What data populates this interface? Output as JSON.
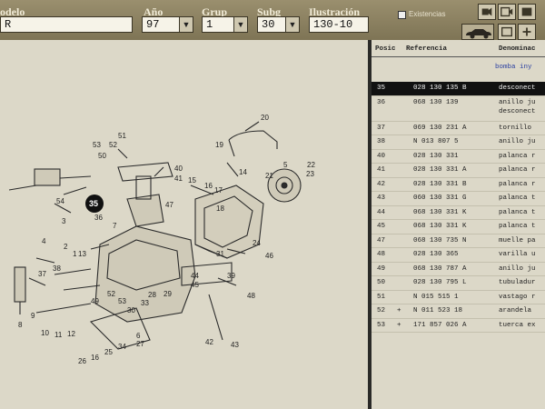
{
  "header": {
    "modelo_label": "odelo",
    "modelo_value": "R",
    "anio_label": "Año",
    "anio_value": "97",
    "grup_label": "Grup",
    "grup_value": "1",
    "subg_label": "Subg",
    "subg_value": "30",
    "ilustracion_label": "Ilustración",
    "ilustracion_value": "130-10",
    "existencias_label": "Existencias"
  },
  "table": {
    "col_posic": "Posic",
    "col_referencia": "Referencia",
    "col_denominacion": "Denominac",
    "group_description": "bomba iny",
    "rows": [
      {
        "pos": "35",
        "mark": "",
        "ref": "028 130 135 B",
        "desc": "desconect",
        "desc2": "",
        "selected": true
      },
      {
        "pos": "36",
        "mark": "",
        "ref": "068 130 139",
        "desc": "anillo ju",
        "desc2": "desconect",
        "selected": false
      },
      {
        "pos": "37",
        "mark": "",
        "ref": "069 130 231 A",
        "desc": "tornillo",
        "desc2": "",
        "selected": false
      },
      {
        "pos": "38",
        "mark": "",
        "ref": "N   013 807 5",
        "desc": "anillo ju",
        "desc2": "",
        "selected": false
      },
      {
        "pos": "40",
        "mark": "",
        "ref": "028 130 331",
        "desc": "palanca r",
        "desc2": "",
        "selected": false
      },
      {
        "pos": "41",
        "mark": "",
        "ref": "028 130 331 A",
        "desc": "palanca r",
        "desc2": "",
        "selected": false
      },
      {
        "pos": "42",
        "mark": "",
        "ref": "028 130 331 B",
        "desc": "palanca r",
        "desc2": "",
        "selected": false
      },
      {
        "pos": "43",
        "mark": "",
        "ref": "060 130 331 G",
        "desc": "palanca t",
        "desc2": "",
        "selected": false
      },
      {
        "pos": "44",
        "mark": "",
        "ref": "068 130 331 K",
        "desc": "palanca t",
        "desc2": "",
        "selected": false
      },
      {
        "pos": "45",
        "mark": "",
        "ref": "068 130 331 K",
        "desc": "palanca t",
        "desc2": "",
        "selected": false
      },
      {
        "pos": "47",
        "mark": "",
        "ref": "068 130 735 N",
        "desc": "muelle pa",
        "desc2": "",
        "selected": false
      },
      {
        "pos": "48",
        "mark": "",
        "ref": "028 130 365",
        "desc": "varilla u",
        "desc2": "",
        "selected": false
      },
      {
        "pos": "49",
        "mark": "",
        "ref": "068 130 787 A",
        "desc": "anillo ju",
        "desc2": "",
        "selected": false
      },
      {
        "pos": "50",
        "mark": "",
        "ref": "028 130 795 L",
        "desc": "tubuladur",
        "desc2": "",
        "selected": false
      },
      {
        "pos": "51",
        "mark": "",
        "ref": "N   015 515 1",
        "desc": "vastago r",
        "desc2": "",
        "selected": false
      },
      {
        "pos": "52",
        "mark": "+",
        "ref": "N   011 523 18",
        "desc": "arandela",
        "desc2": "",
        "selected": false
      },
      {
        "pos": "53",
        "mark": "+",
        "ref": "171 857 026 A",
        "desc": "tuerca ex",
        "desc2": "",
        "selected": false
      }
    ]
  },
  "diagram": {
    "highlighted_callout": "35",
    "callouts": [
      "53",
      "52",
      "51",
      "50",
      "41",
      "40",
      "54",
      "1",
      "2",
      "3",
      "4",
      "7",
      "13",
      "35",
      "36",
      "47",
      "14",
      "15",
      "16",
      "17",
      "18",
      "19",
      "20",
      "21",
      "5",
      "22",
      "23",
      "24",
      "37",
      "38",
      "8",
      "9",
      "10",
      "11",
      "12",
      "49",
      "52",
      "53",
      "27",
      "28",
      "29",
      "44",
      "45",
      "48",
      "42",
      "43",
      "26",
      "16",
      "25",
      "34",
      "6",
      "33",
      "30",
      "39",
      "31",
      "46"
    ]
  },
  "icons": [
    "dropdown-arrow-icon",
    "checkbox-icon",
    "toolbar-icon",
    "car-icon"
  ],
  "colors": {
    "selected_row": "#111111",
    "highlight_callout": "#111111",
    "accent_text": "#2a3fa0"
  }
}
